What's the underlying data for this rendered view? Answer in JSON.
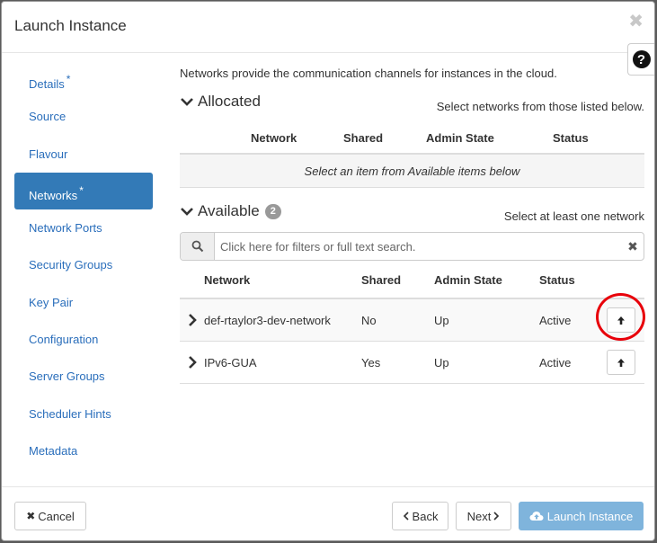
{
  "modal": {
    "title": "Launch Instance",
    "close_icon": "close-icon",
    "help_label": "?"
  },
  "sidebar": {
    "items": [
      {
        "label": "Details",
        "required": "*"
      },
      {
        "label": "Source",
        "required": ""
      },
      {
        "label": "Flavour",
        "required": ""
      },
      {
        "label": "Networks",
        "required": "*",
        "active": true
      },
      {
        "label": "Network Ports",
        "required": ""
      },
      {
        "label": "Security Groups",
        "required": ""
      },
      {
        "label": "Key Pair",
        "required": ""
      },
      {
        "label": "Configuration",
        "required": ""
      },
      {
        "label": "Server Groups",
        "required": ""
      },
      {
        "label": "Scheduler Hints",
        "required": ""
      },
      {
        "label": "Metadata",
        "required": ""
      }
    ]
  },
  "main": {
    "intro": "Networks provide the communication channels for instances in the cloud.",
    "allocated": {
      "title": "Allocated",
      "hint": "Select networks from those listed below.",
      "columns": [
        "Network",
        "Shared",
        "Admin State",
        "Status"
      ],
      "empty_message": "Select an item from Available items below"
    },
    "available": {
      "title": "Available",
      "count": "2",
      "hint": "Select at least one network",
      "search_placeholder": "Click here for filters or full text search.",
      "columns": [
        "Network",
        "Shared",
        "Admin State",
        "Status"
      ],
      "rows": [
        {
          "network": "def-rtaylor3-dev-network",
          "shared": "No",
          "admin_state": "Up",
          "status": "Active"
        },
        {
          "network": "IPv6-GUA",
          "shared": "Yes",
          "admin_state": "Up",
          "status": "Active"
        }
      ]
    }
  },
  "footer": {
    "cancel_label": "Cancel",
    "back_label": "Back",
    "next_label": "Next",
    "launch_label": "Launch Instance"
  },
  "colors": {
    "accent": "#337ab7",
    "link": "#2a6ebb",
    "launch_disabled": "#7fb4dc",
    "highlight": "#e8000a"
  }
}
